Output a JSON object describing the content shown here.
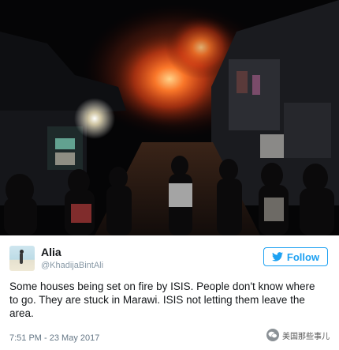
{
  "tweet": {
    "author_name": "Alia",
    "author_handle": "@KhadijaBintAli",
    "follow_label": "Follow",
    "text": "Some houses being set on fire by ISIS. People don't know where to go. They are stuck in Marawi. ISIS not letting them leave the area.",
    "timestamp": "7:51 PM - 23 May 2017"
  },
  "watermark": {
    "text": "美国那些事儿"
  },
  "colors": {
    "accent": "#1da1f2",
    "fire": "#ff5a1f",
    "night_sky": "#050506"
  },
  "icons": {
    "follow": "twitter-bird-icon",
    "watermark": "wechat-logo-icon"
  }
}
